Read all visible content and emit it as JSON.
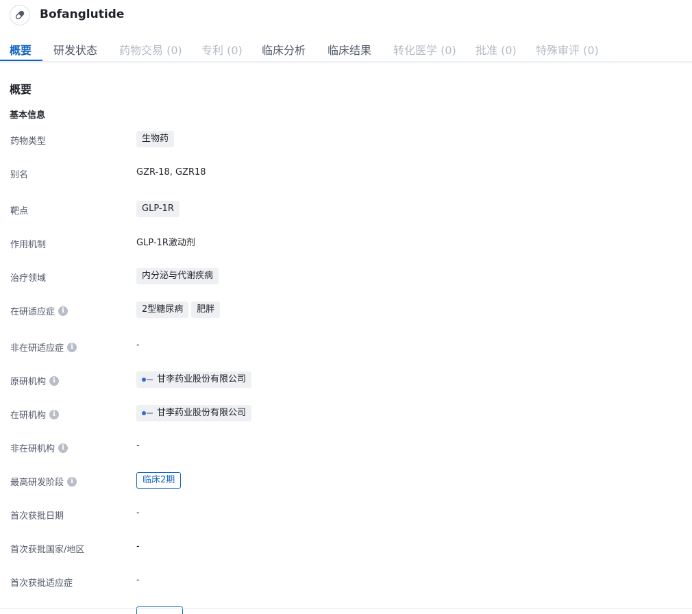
{
  "header": {
    "drug_name": "Bofanglutide",
    "drug_icon": "pill-icon"
  },
  "tabs": [
    {
      "label": "概要",
      "state": "active"
    },
    {
      "label": "研发状态",
      "state": "enabled"
    },
    {
      "label": "药物交易 (0)",
      "state": "disabled"
    },
    {
      "label": "专利 (0)",
      "state": "disabled"
    },
    {
      "label": "临床分析",
      "state": "enabled"
    },
    {
      "label": "临床结果",
      "state": "enabled"
    },
    {
      "label": "转化医学 (0)",
      "state": "disabled"
    },
    {
      "label": "批准 (0)",
      "state": "disabled"
    },
    {
      "label": "特殊审评 (0)",
      "state": "disabled"
    }
  ],
  "overview": {
    "title": "概要",
    "basic_info_title": "基本信息"
  },
  "fields": {
    "drug_type": {
      "label": "药物类型",
      "chips": [
        "生物药"
      ]
    },
    "alias": {
      "label": "别名",
      "value": "GZR-18,  GZR18"
    },
    "target": {
      "label": "靶点",
      "chips": [
        "GLP-1R"
      ]
    },
    "mechanism": {
      "label": "作用机制",
      "value": "GLP-1R激动剂"
    },
    "therapeutic_area": {
      "label": "治疗领域",
      "chips": [
        "内分泌与代谢疾病"
      ]
    },
    "active_indications": {
      "label": "在研适应症",
      "chips": [
        "2型糖尿病",
        "肥胖"
      ]
    },
    "inactive_indications": {
      "label": "非在研适应症",
      "value": "-"
    },
    "originator": {
      "label": "原研机构",
      "org": "甘李药业股份有限公司"
    },
    "active_org": {
      "label": "在研机构",
      "org": "甘李药业股份有限公司"
    },
    "inactive_org": {
      "label": "非在研机构",
      "value": "-"
    },
    "highest_phase": {
      "label": "最高研发阶段",
      "tag": "临床2期"
    },
    "first_approval_date": {
      "label": "首次获批日期",
      "value": "-"
    },
    "first_approval_region": {
      "label": "首次获批国家/地区",
      "value": "-"
    },
    "first_approval_indication": {
      "label": "首次获批适应症",
      "value": "-"
    }
  },
  "colors": {
    "accent": "#1565c0",
    "chip_bg": "#eef0f3",
    "label_text": "#4e5969",
    "disabled_tab": "#b5bbc4"
  }
}
